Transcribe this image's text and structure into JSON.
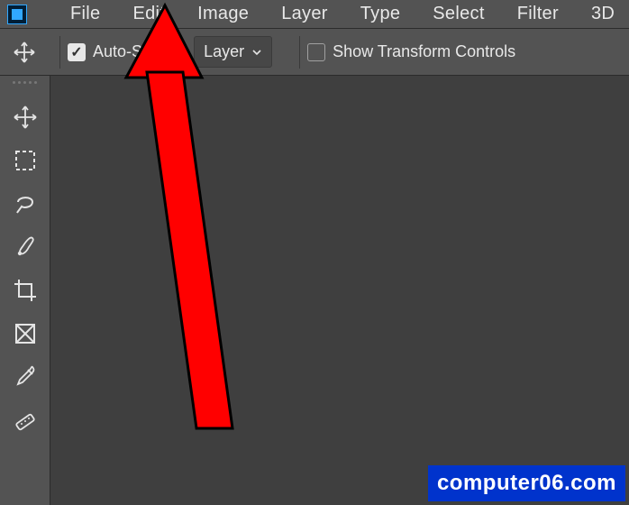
{
  "menubar": {
    "items": [
      {
        "label": "File"
      },
      {
        "label": "Edit"
      },
      {
        "label": "Image"
      },
      {
        "label": "Layer"
      },
      {
        "label": "Type"
      },
      {
        "label": "Select"
      },
      {
        "label": "Filter"
      },
      {
        "label": "3D"
      }
    ]
  },
  "optionsbar": {
    "auto_select_checked": true,
    "auto_select_label": "Auto-Select:",
    "select_mode": "Layer",
    "show_transform_checked": false,
    "show_transform_label": "Show Transform Controls"
  },
  "toolbar": {
    "tools": [
      {
        "name": "move-tool-icon"
      },
      {
        "name": "marquee-tool-icon"
      },
      {
        "name": "lasso-tool-icon"
      },
      {
        "name": "brush-tool-icon"
      },
      {
        "name": "crop-tool-icon"
      },
      {
        "name": "frame-tool-icon"
      },
      {
        "name": "eyedropper-tool-icon"
      },
      {
        "name": "healing-tool-icon"
      }
    ]
  },
  "watermark": {
    "text": "computer06.com"
  },
  "annotation": {
    "arrow_target": "Edit menu"
  }
}
